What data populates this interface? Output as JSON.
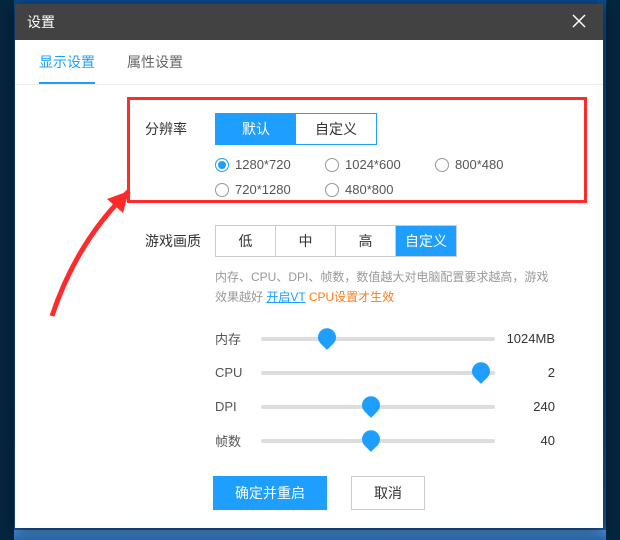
{
  "title": "设置",
  "tabs": {
    "display": "显示设置",
    "attr": "属性设置"
  },
  "resolution": {
    "label": "分辨率",
    "modes": {
      "default": "默认",
      "custom": "自定义"
    },
    "options": [
      "1280*720",
      "1024*600",
      "800*480",
      "720*1280",
      "480*800"
    ]
  },
  "quality": {
    "label": "游戏画质",
    "levels": {
      "low": "低",
      "mid": "中",
      "high": "高",
      "custom": "自定义"
    }
  },
  "hint": {
    "line1": "内存、CPU、DPI、帧数，数值越大对电脑配置要求越高，游戏效果越好",
    "link": "开启VT",
    "suffix": " CPU设置才生效"
  },
  "sliders": {
    "mem": {
      "label": "内存",
      "value": "1024MB",
      "pos": 28
    },
    "cpu": {
      "label": "CPU",
      "value": "2",
      "pos": 94
    },
    "dpi": {
      "label": "DPI",
      "value": "240",
      "pos": 47
    },
    "fps": {
      "label": "帧数",
      "value": "40",
      "pos": 47
    }
  },
  "buttons": {
    "ok": "确定并重启",
    "cancel": "取消"
  }
}
